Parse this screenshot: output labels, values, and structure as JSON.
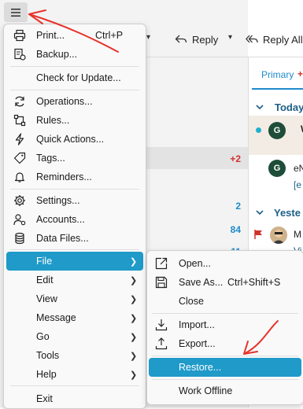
{
  "toolbar": {
    "reply_label": "Reply",
    "reply_all_label": "Reply All"
  },
  "folder_counts": [
    "+2",
    "2",
    "84",
    "11"
  ],
  "message_list": {
    "tab_primary": "Primary",
    "tab_indicator": "+",
    "group_today": "Today",
    "group_yesterday": "Yeste",
    "avatar_initial": "G",
    "snippets": [
      "W",
      "eN",
      "[e",
      "M",
      "Vi"
    ]
  },
  "main_menu": {
    "items": [
      {
        "label": "Print...",
        "shortcut": "Ctrl+P",
        "icon": "printer-icon"
      },
      {
        "label": "Backup...",
        "icon": "backup-icon"
      },
      {
        "label": "Check for Update..."
      },
      {
        "label": "Operations...",
        "icon": "sync-icon"
      },
      {
        "label": "Rules...",
        "icon": "rules-icon"
      },
      {
        "label": "Quick Actions...",
        "icon": "lightning-icon"
      },
      {
        "label": "Tags...",
        "icon": "tag-icon"
      },
      {
        "label": "Reminders...",
        "icon": "bell-icon"
      },
      {
        "label": "Settings...",
        "icon": "gear-icon"
      },
      {
        "label": "Accounts...",
        "icon": "accounts-icon"
      },
      {
        "label": "Data Files...",
        "icon": "database-icon"
      },
      {
        "label": "File"
      },
      {
        "label": "Edit"
      },
      {
        "label": "View"
      },
      {
        "label": "Message"
      },
      {
        "label": "Go"
      },
      {
        "label": "Tools"
      },
      {
        "label": "Help"
      },
      {
        "label": "Exit"
      }
    ]
  },
  "file_submenu": {
    "items": [
      {
        "label": "Open...",
        "icon": "open-icon"
      },
      {
        "label": "Save As...",
        "shortcut": "Ctrl+Shift+S",
        "icon": "save-icon"
      },
      {
        "label": "Close"
      },
      {
        "label": "Import...",
        "icon": "import-icon"
      },
      {
        "label": "Export...",
        "icon": "export-icon"
      },
      {
        "label": "Restore..."
      },
      {
        "label": "Work Offline"
      }
    ]
  },
  "colors": {
    "accent": "#1f9ac9",
    "count_red": "#d0312d",
    "count_blue": "#1f8bcc",
    "annotation_red": "#e8322b"
  }
}
